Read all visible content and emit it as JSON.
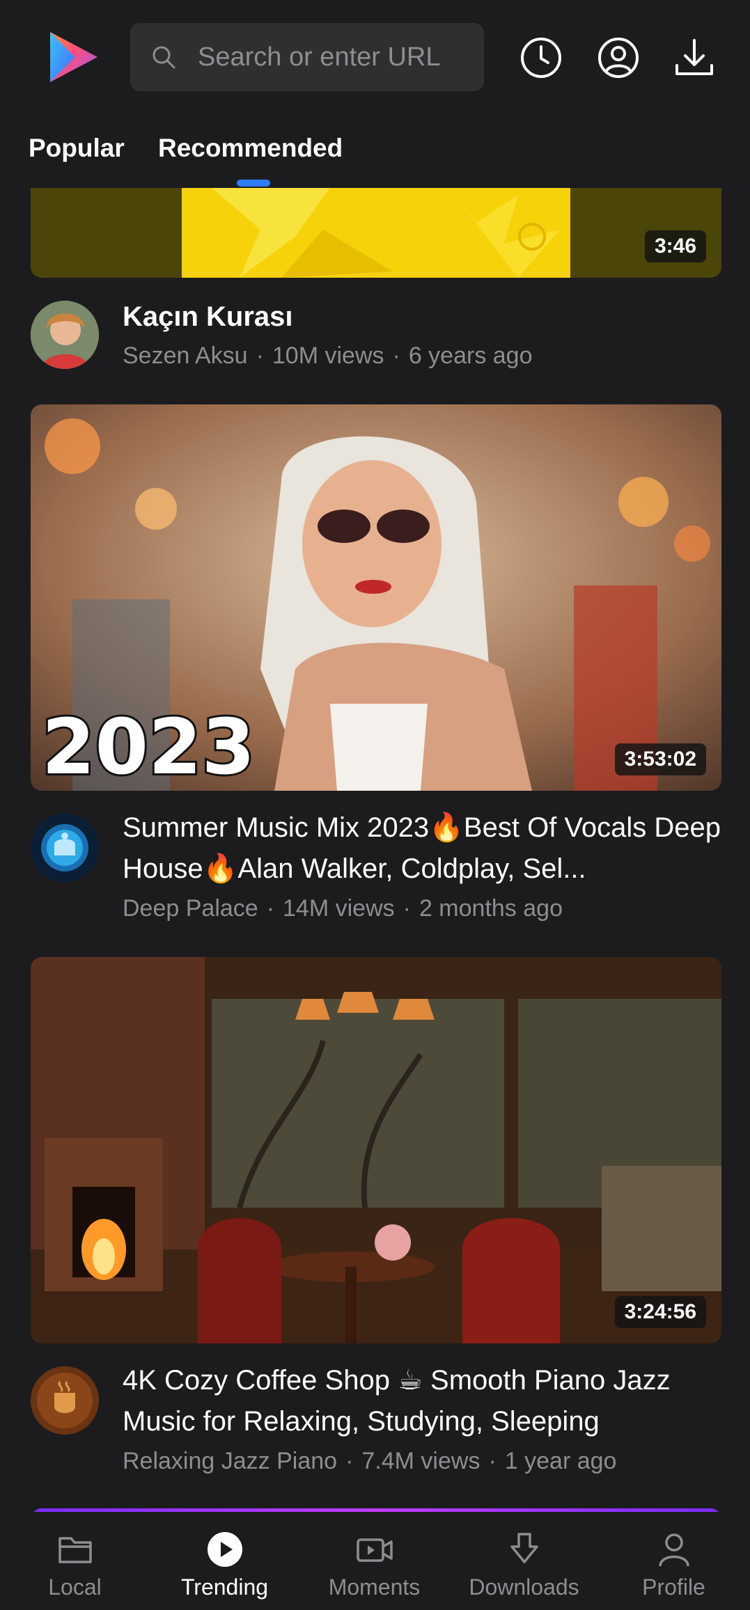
{
  "search": {
    "placeholder": "Search or enter URL"
  },
  "tabs": [
    {
      "label": "Popular",
      "active": false
    },
    {
      "label": "Recommended",
      "active": true
    }
  ],
  "videos": [
    {
      "title": "Kaçın Kurası",
      "channel": "Sezen Aksu",
      "views": "10M views",
      "age": "6 years ago",
      "duration": "3:46"
    },
    {
      "title": "Summer Music Mix 2023🔥Best Of Vocals Deep House🔥Alan Walker, Coldplay, Sel...",
      "channel": "Deep Palace",
      "views": "14M views",
      "age": "2 months ago",
      "duration": "3:53:02",
      "thumb_text": "2023"
    },
    {
      "title": "4K Cozy Coffee Shop ☕ Smooth Piano Jazz Music for Relaxing, Studying, Sleeping",
      "channel": "Relaxing Jazz Piano",
      "views": "7.4M views",
      "age": "1 year ago",
      "duration": "3:24:56"
    }
  ],
  "nav": [
    {
      "label": "Local",
      "icon": "folder-icon",
      "active": false
    },
    {
      "label": "Trending",
      "icon": "play-circle-icon",
      "active": true
    },
    {
      "label": "Moments",
      "icon": "video-camera-icon",
      "active": false
    },
    {
      "label": "Downloads",
      "icon": "download-icon",
      "active": false
    },
    {
      "label": "Profile",
      "icon": "person-icon",
      "active": false
    }
  ],
  "colors": {
    "background": "#1c1c1e",
    "accent": "#2f7cf6",
    "secondary_text": "#8e8e92"
  }
}
